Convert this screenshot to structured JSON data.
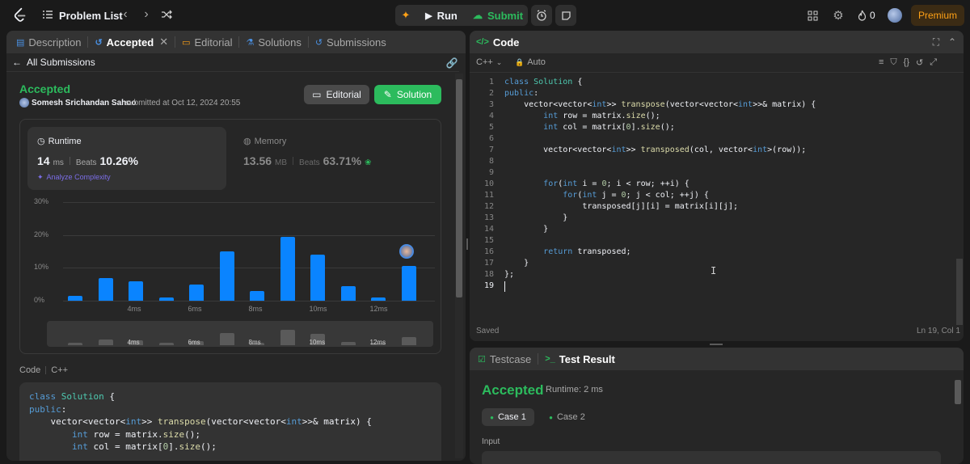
{
  "topbar": {
    "problem_list": "Problem List",
    "run": "Run",
    "submit": "Submit",
    "streak": "0",
    "premium": "Premium"
  },
  "left_tabs": [
    {
      "label": "Description"
    },
    {
      "label": "Accepted"
    },
    {
      "label": "Editorial"
    },
    {
      "label": "Solutions"
    },
    {
      "label": "Submissions"
    }
  ],
  "submission": {
    "back": "All Submissions",
    "status": "Accepted",
    "user": "Somesh Srichandan Sahoo",
    "submitted_at": "submitted at Oct 12, 2024 20:55",
    "editorial_btn": "Editorial",
    "solution_btn": "Solution",
    "runtime_label": "Runtime",
    "runtime_value": "14",
    "runtime_unit": "ms",
    "runtime_beats_label": "Beats",
    "runtime_beats": "10.26%",
    "analyze": "Analyze Complexity",
    "memory_label": "Memory",
    "memory_value": "13.56",
    "memory_unit": "MB",
    "memory_beats_label": "Beats",
    "memory_beats": "63.71%",
    "code_label": "Code",
    "code_lang": "C++"
  },
  "chart_data": {
    "type": "bar",
    "yticks": [
      "30%",
      "20%",
      "10%",
      "0%"
    ],
    "xticks": [
      "4ms",
      "6ms",
      "8ms",
      "10ms",
      "12ms"
    ],
    "values": [
      1.5,
      7,
      6,
      1,
      5,
      15,
      3,
      19.5,
      14,
      4.5,
      1,
      10.5
    ],
    "ylim": [
      0,
      30
    ],
    "minimap_xticks": [
      "4ms",
      "6ms",
      "8ms",
      "10ms",
      "12ms"
    ]
  },
  "left_code": [
    "class Solution {",
    "public:",
    "    vector<vector<int>> transpose(vector<vector<int>>& matrix) {",
    "        int row = matrix.size();",
    "        int col = matrix[0].size();"
  ],
  "editor": {
    "title": "Code",
    "lang": "C++",
    "mode": "Auto",
    "saved": "Saved",
    "position": "Ln 19, Col 1",
    "line_numbers": [
      "1",
      "2",
      "3",
      "4",
      "5",
      "6",
      "7",
      "8",
      "9",
      "10",
      "11",
      "12",
      "13",
      "14",
      "15",
      "16",
      "17",
      "18",
      "19"
    ]
  },
  "result": {
    "testcase_tab": "Testcase",
    "result_tab": "Test Result",
    "status": "Accepted",
    "runtime": "Runtime: 2 ms",
    "case1": "Case 1",
    "case2": "Case 2",
    "input_label": "Input"
  },
  "colors": {
    "accent_green": "#2cbb5d",
    "bar_blue": "#0a84ff",
    "premium": "#ffa116"
  }
}
